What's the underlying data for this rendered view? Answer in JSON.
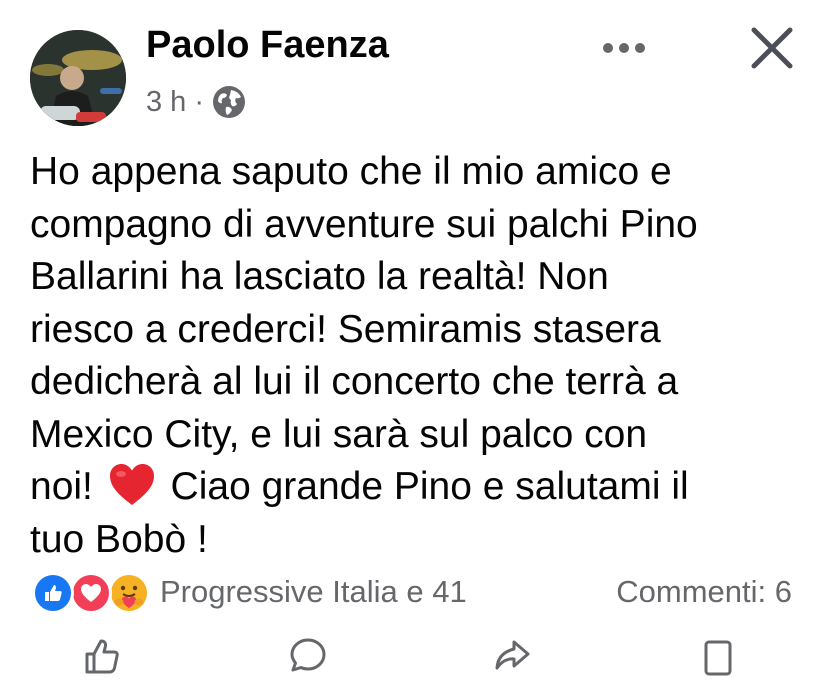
{
  "post": {
    "author": "Paolo Faenza",
    "time": "3 h",
    "separator": "·",
    "visibility_icon": "globe-icon",
    "text_before_emoji": "Ho appena saputo che il mio amico e\ncompagno di avventure sui palchi Pino\nBallarini ha lasciato la realtà! Non\nriesco a crederci! Semiramis stasera\ndedicherà al lui il concerto che terrà a\nMexico City, e lui sarà sul palco con\nnoi! ",
    "text_after_emoji": " Ciao grande Pino e salutami il\ntuo Bobò !",
    "inline_emoji": "heart-emoji"
  },
  "header": {
    "more_icon": "more-dots-icon",
    "close_icon": "close-icon"
  },
  "reactions": {
    "icons": [
      "like-icon",
      "love-icon",
      "care-icon"
    ],
    "summary": "Progressive Italia e 41",
    "comments": "Commenti: 6"
  },
  "actions": {
    "icons": [
      "like-action-icon",
      "comment-action-icon",
      "share-action-icon",
      "save-action-icon"
    ]
  },
  "colors": {
    "text": "#050505",
    "secondary_text": "#65676b",
    "like_blue": "#1877f2",
    "love_red": "#f33e58",
    "care_yellow": "#f7b125",
    "heart_red": "#e5252f"
  }
}
